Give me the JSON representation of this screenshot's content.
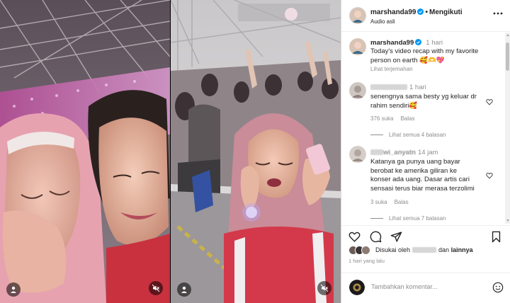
{
  "post": {
    "username": "marshanda99",
    "follow_label": "Mengikuti",
    "audio_label": "Audio asli",
    "caption_time": "1 hari",
    "caption": "Today's video recap with my favorite person on earth 🥰🫶💖",
    "translate_label": "Lihat terjemahan"
  },
  "comments": [
    {
      "time": "1 hari",
      "text": "senengnya sama besty yg keluar dr rahim sendiri🥰",
      "likes": "376 suka",
      "reply_label": "Balas",
      "view_replies": "Lihat semua 4 balasan"
    },
    {
      "username_partial": "wi_anyatn",
      "time": "14 jam",
      "text": "Katanya ga punya uang bayar berobat ke amerika giliran ke konser ada uang. Dasar artis cari sensasi terus biar merasa terzolimi",
      "likes": "3 suka",
      "reply_label": "Balas",
      "view_replies": "Lihat semua 7 balasan"
    }
  ],
  "likes": {
    "prefix": "Disukai oleh",
    "suffix": "dan",
    "others": "lainnya"
  },
  "post_date": "1 hari yang lalu",
  "add_comment": {
    "placeholder": "Tambahkan komentar..."
  },
  "icons": {
    "header": [
      "verified-badge-icon",
      "more-options-icon"
    ],
    "actions": [
      "heart-icon",
      "comment-icon",
      "share-icon",
      "bookmark-icon"
    ],
    "media": [
      "user-tag-icon",
      "mute-icon"
    ],
    "input": [
      "emoji-icon"
    ]
  },
  "colors": {
    "verified": "#0095f6",
    "secondary_text": "#8e8e8e",
    "primary_text": "#262626",
    "divider": "#efefef"
  }
}
